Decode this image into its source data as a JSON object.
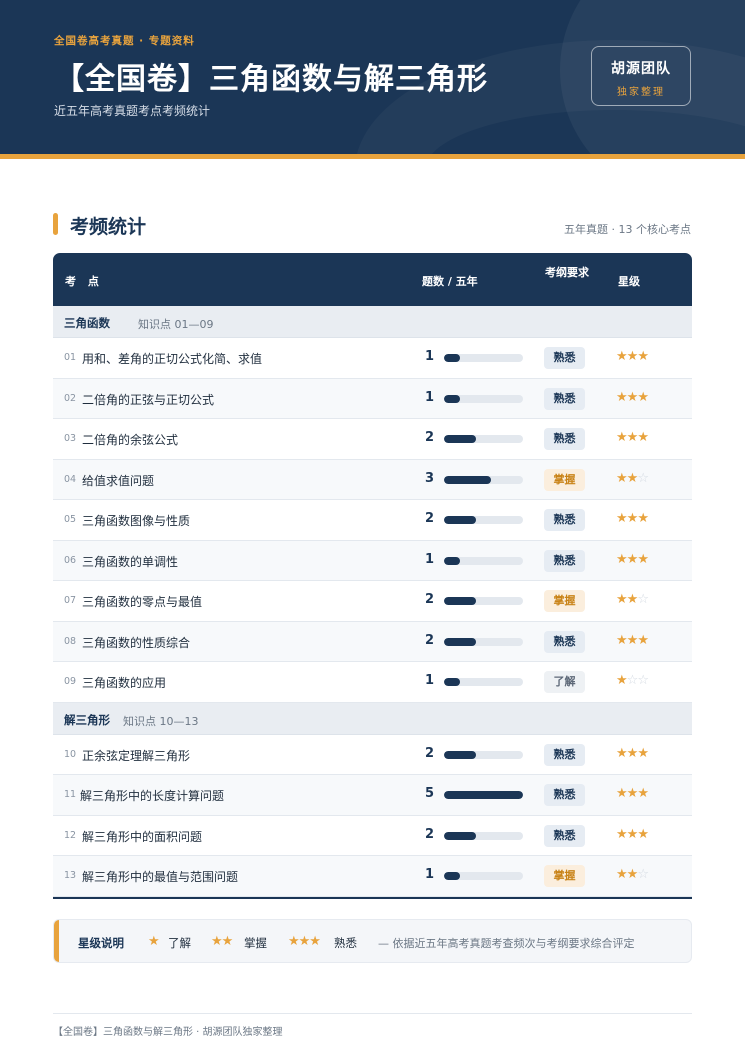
{
  "header": {
    "kicker": "全国卷高考真题 · 专题资料",
    "title": "【全国卷】三角函数与解三角形",
    "subtitle": "近五年高考真题考点考频统计",
    "badge_name": "胡源团队",
    "badge_sub": "独家整理"
  },
  "section": {
    "title": "考频统计",
    "note": "五年真题 · 13 个核心考点"
  },
  "table": {
    "col_topic": "考 点",
    "col_count": "题数 / 五年",
    "col_req": "考纲要求",
    "col_star": "星级",
    "max_count": 5,
    "groups": [
      {
        "name": "三角函数",
        "range": "知识点 01—09",
        "rows": [
          {
            "no": "01",
            "topic": "用和、差角的正切公式化简、求值",
            "count": 1,
            "req": "熟悉",
            "stars": 3
          },
          {
            "no": "02",
            "topic": "二倍角的正弦与正切公式",
            "count": 1,
            "req": "熟悉",
            "stars": 3
          },
          {
            "no": "03",
            "topic": "二倍角的余弦公式",
            "count": 2,
            "req": "熟悉",
            "stars": 3
          },
          {
            "no": "04",
            "topic": "给值求值问题",
            "count": 3,
            "req": "掌握",
            "stars": 2
          },
          {
            "no": "05",
            "topic": "三角函数图像与性质",
            "count": 2,
            "req": "熟悉",
            "stars": 3
          },
          {
            "no": "06",
            "topic": "三角函数的单调性",
            "count": 1,
            "req": "熟悉",
            "stars": 3
          },
          {
            "no": "07",
            "topic": "三角函数的零点与最值",
            "count": 2,
            "req": "掌握",
            "stars": 2
          },
          {
            "no": "08",
            "topic": "三角函数的性质综合",
            "count": 2,
            "req": "熟悉",
            "stars": 3
          },
          {
            "no": "09",
            "topic": "三角函数的应用",
            "count": 1,
            "req": "了解",
            "stars": 1
          }
        ]
      },
      {
        "name": "解三角形",
        "range": "知识点 10—13",
        "rows": [
          {
            "no": "10",
            "topic": "正余弦定理解三角形",
            "count": 2,
            "req": "熟悉",
            "stars": 3
          },
          {
            "no": "11",
            "topic": "解三角形中的长度计算问题",
            "count": 5,
            "req": "熟悉",
            "stars": 3
          },
          {
            "no": "12",
            "topic": "解三角形中的面积问题",
            "count": 2,
            "req": "熟悉",
            "stars": 3
          },
          {
            "no": "13",
            "topic": "解三角形中的最值与范围问题",
            "count": 1,
            "req": "掌握",
            "stars": 2
          }
        ]
      }
    ]
  },
  "legend": {
    "title": "星级说明",
    "items": [
      {
        "stars": "★",
        "label": "了解"
      },
      {
        "stars": "★★",
        "label": "掌握"
      },
      {
        "stars": "★★★",
        "label": "熟悉"
      }
    ],
    "note": "— 依据近五年高考真题考查频次与考纲要求综合评定"
  },
  "footer": "【全国卷】三角函数与解三角形 · 胡源团队独家整理",
  "colors": {
    "navy": "#1b3656",
    "accent": "#e8a33d"
  }
}
